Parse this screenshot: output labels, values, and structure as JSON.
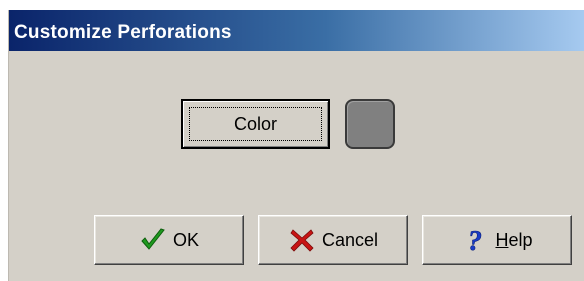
{
  "window": {
    "title": "Customize Perforations"
  },
  "color_picker": {
    "button_label": "Color",
    "swatch_color": "#808080"
  },
  "footer": {
    "ok_label": "OK",
    "cancel_label": "Cancel",
    "help_label_hotkey": "H",
    "help_label_rest": "elp"
  },
  "icons": {
    "ok": "checkmark-icon",
    "cancel": "x-icon",
    "help": "question-mark-icon"
  },
  "colors": {
    "title_gradient_start": "#0a246a",
    "title_gradient_end": "#a6caf0",
    "dialog_background": "#d4d0c8",
    "ok_icon": "#1f9a1f",
    "cancel_icon": "#c81414",
    "help_icon": "#1a3cc8"
  }
}
